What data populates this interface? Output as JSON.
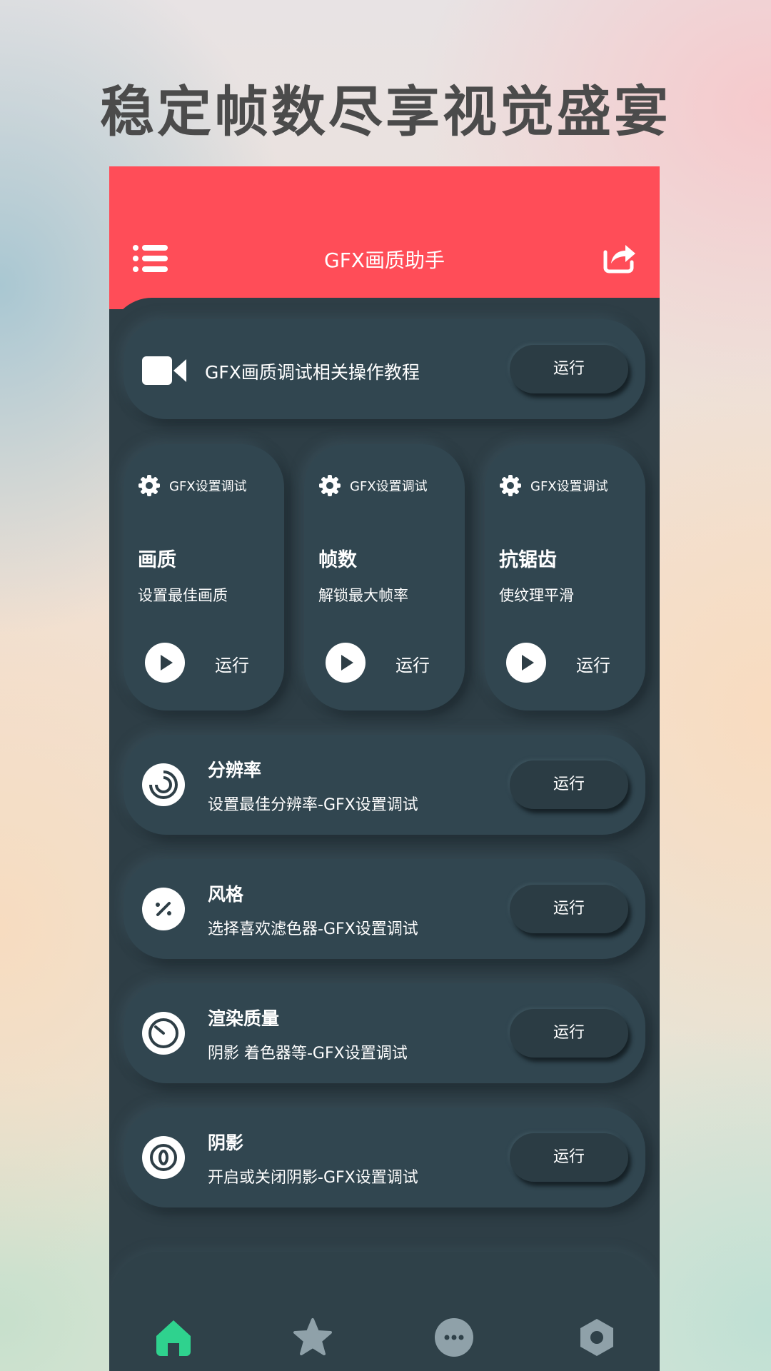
{
  "promo": {
    "headline": "稳定帧数尽享视觉盛宴"
  },
  "appbar": {
    "title": "GFX画质助手"
  },
  "tutorial": {
    "label": "GFX画质调试相关操作教程",
    "run": "运行"
  },
  "tiles": [
    {
      "header": "GFX设置调试",
      "title": "画质",
      "subtitle": "设置最佳画质",
      "run": "运行"
    },
    {
      "header": "GFX设置调试",
      "title": "帧数",
      "subtitle": "解锁最大帧率",
      "run": "运行"
    },
    {
      "header": "GFX设置调试",
      "title": "抗锯齿",
      "subtitle": "使纹理平滑",
      "run": "运行"
    }
  ],
  "rows": [
    {
      "title": "分辨率",
      "subtitle": "设置最佳分辨率-GFX设置调试",
      "run": "运行",
      "icon": "resolution-icon"
    },
    {
      "title": "风格",
      "subtitle": "选择喜欢滤色器-GFX设置调试",
      "run": "运行",
      "icon": "percent-icon"
    },
    {
      "title": "渲染质量",
      "subtitle": "阴影 着色器等-GFX设置调试",
      "run": "运行",
      "icon": "gauge-icon"
    },
    {
      "title": "阴影",
      "subtitle": "开启或关闭阴影-GFX设置调试",
      "run": "运行",
      "icon": "zero-circle-icon"
    }
  ],
  "nav": {
    "items": [
      "home-icon",
      "star-icon",
      "more-icon",
      "hexagon-icon"
    ],
    "active_color": "#2fd28e",
    "inactive_color": "#8fa1a9"
  },
  "colors": {
    "accent": "#ff4d58",
    "panel": "#2e3e46"
  }
}
